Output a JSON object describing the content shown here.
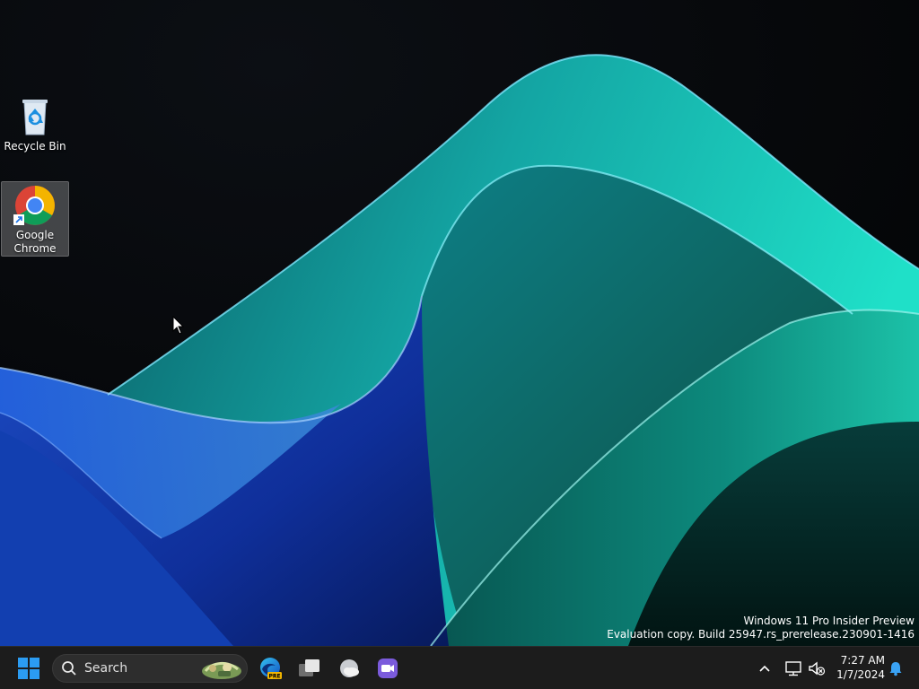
{
  "desktop": {
    "icons": [
      {
        "label": "Recycle Bin",
        "icon": "recycle-bin-icon"
      },
      {
        "label": "Google Chrome",
        "icon": "chrome-icon",
        "selected": true
      }
    ]
  },
  "watermark": {
    "line1": "Windows 11 Pro Insider Preview",
    "line2": "Evaluation copy. Build 25947.rs_prerelease.230901-1416"
  },
  "taskbar": {
    "start_icon": "windows-logo-icon",
    "search": {
      "placeholder": "Search"
    },
    "pinned": [
      {
        "name": "edge-preview",
        "icon": "edge-icon",
        "badge": "PRE"
      },
      {
        "name": "task-view",
        "icon": "task-view-icon"
      },
      {
        "name": "widgets",
        "icon": "weather-icon"
      },
      {
        "name": "teams",
        "icon": "teams-icon"
      }
    ],
    "tray": {
      "time": "7:27 AM",
      "date": "1/7/2024"
    }
  },
  "colors": {
    "taskbar_bg": "#1c1c1c",
    "accent_blue": "#0078d4",
    "wallpaper_teal": "#1fd6c0",
    "wallpaper_blue": "#1e4fc7"
  }
}
